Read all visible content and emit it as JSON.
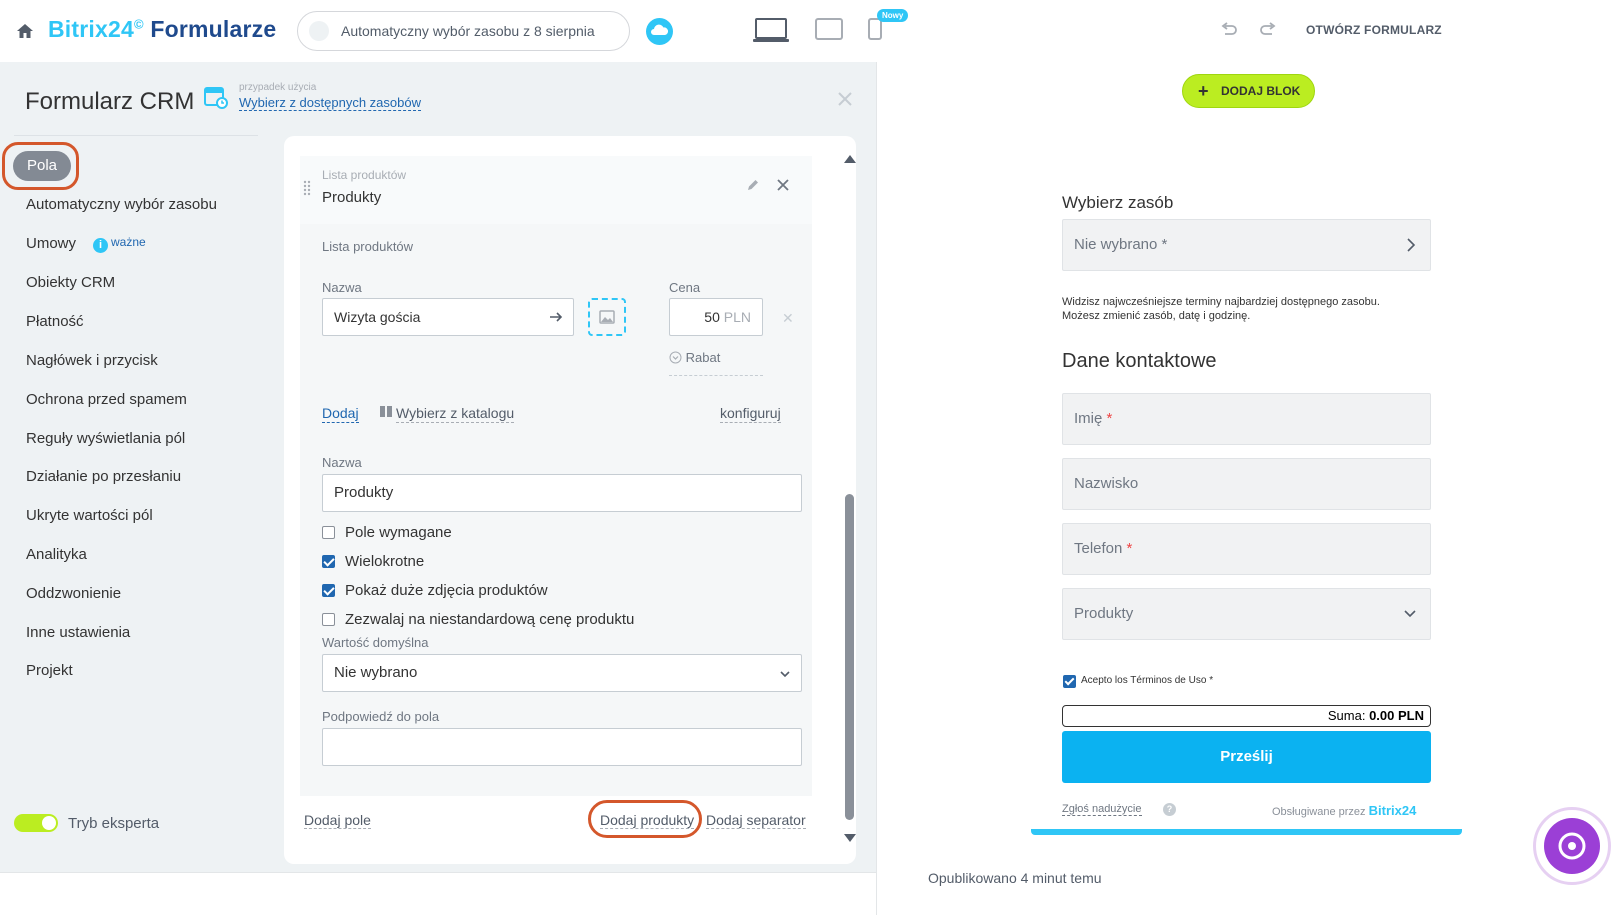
{
  "topbar": {
    "brand_part1": "Bitrix24",
    "brand_sup": "©",
    "brand_part2": "Formularze",
    "scenario": "Automatyczny wybór zasobu z 8 sierpnia",
    "new_badge": "Nowy",
    "open_form": "OTWÓRZ FORMULARZ"
  },
  "editor": {
    "title": "Formularz CRM",
    "usecase_small": "przypadek użycia",
    "usecase_link": "Wybierz z dostępnych zasobów"
  },
  "nav": {
    "active": "Pola",
    "items": [
      "Automatyczny wybór zasobu",
      "Umowy",
      "Obiekty CRM",
      "Płatność",
      "Nagłówek i przycisk",
      "Ochrona przed spamem",
      "Reguły wyświetlania pól",
      "Działanie po przesłaniu",
      "Ukryte wartości pól",
      "Analityka",
      "Oddzwonienie",
      "Inne ustawienia",
      "Projekt"
    ],
    "umowy_badge": "ważne",
    "expert_label": "Tryb eksperta"
  },
  "field": {
    "header_small": "Lista produktów",
    "header_title": "Produkty",
    "body_title": "Lista produktów",
    "name_label": "Nazwa",
    "product_name": "Wizyta gościa",
    "price_label": "Cena",
    "price_value": "50",
    "price_currency": "PLN",
    "rabat": "Rabat",
    "add_link": "Dodaj",
    "catalog_link": "Wybierz z katalogu",
    "configure_link": "konfiguruj",
    "field_name_label": "Nazwa",
    "field_name_value": "Produkty",
    "checkboxes": [
      {
        "label": "Pole wymagane",
        "checked": false
      },
      {
        "label": "Wielokrotne",
        "checked": true
      },
      {
        "label": "Pokaż duże zdjęcia produktów",
        "checked": true
      },
      {
        "label": "Zezwalaj na niestandardową cenę produktu",
        "checked": false
      }
    ],
    "default_label": "Wartość domyślna",
    "default_value": "Nie wybrano",
    "hint_label": "Podpowiedź do pola",
    "hint_value": ""
  },
  "footer": {
    "add_field": "Dodaj pole",
    "add_products": "Dodaj produkty",
    "add_separator": "Dodaj separator"
  },
  "preview": {
    "add_block": "DODAJ BLOK",
    "resource_title": "Wybierz zasób",
    "resource_placeholder": "Nie wybrano",
    "resource_star": "*",
    "resource_note_line1": "Widzisz najwcześniejsze terminy najbardziej dostępnego zasobu.",
    "resource_note_line2": "Możesz zmienić zasób, datę i godzinę.",
    "contact_title": "Dane kontaktowe",
    "field_first_name": "Imię",
    "field_last_name": "Nazwisko",
    "field_phone": "Telefon",
    "field_products": "Produkty",
    "required_star": "*",
    "terms": "Acepto los Términos de Uso *",
    "sum_label": "Suma:",
    "sum_value": "0.00 PLN",
    "submit": "Prześlij",
    "abuse": "Zgłoś nadużycie",
    "powered_by": "Obsługiwane przez",
    "powered_brand": "Bitrix24",
    "published": "Opublikowano 4 minut temu"
  },
  "colors": {
    "accent": "#2fc6f6",
    "link": "#2067b0",
    "highlight_ring": "#d4572b",
    "add_block_green": "#bbed21",
    "submit_blue": "#0bb2f1"
  }
}
